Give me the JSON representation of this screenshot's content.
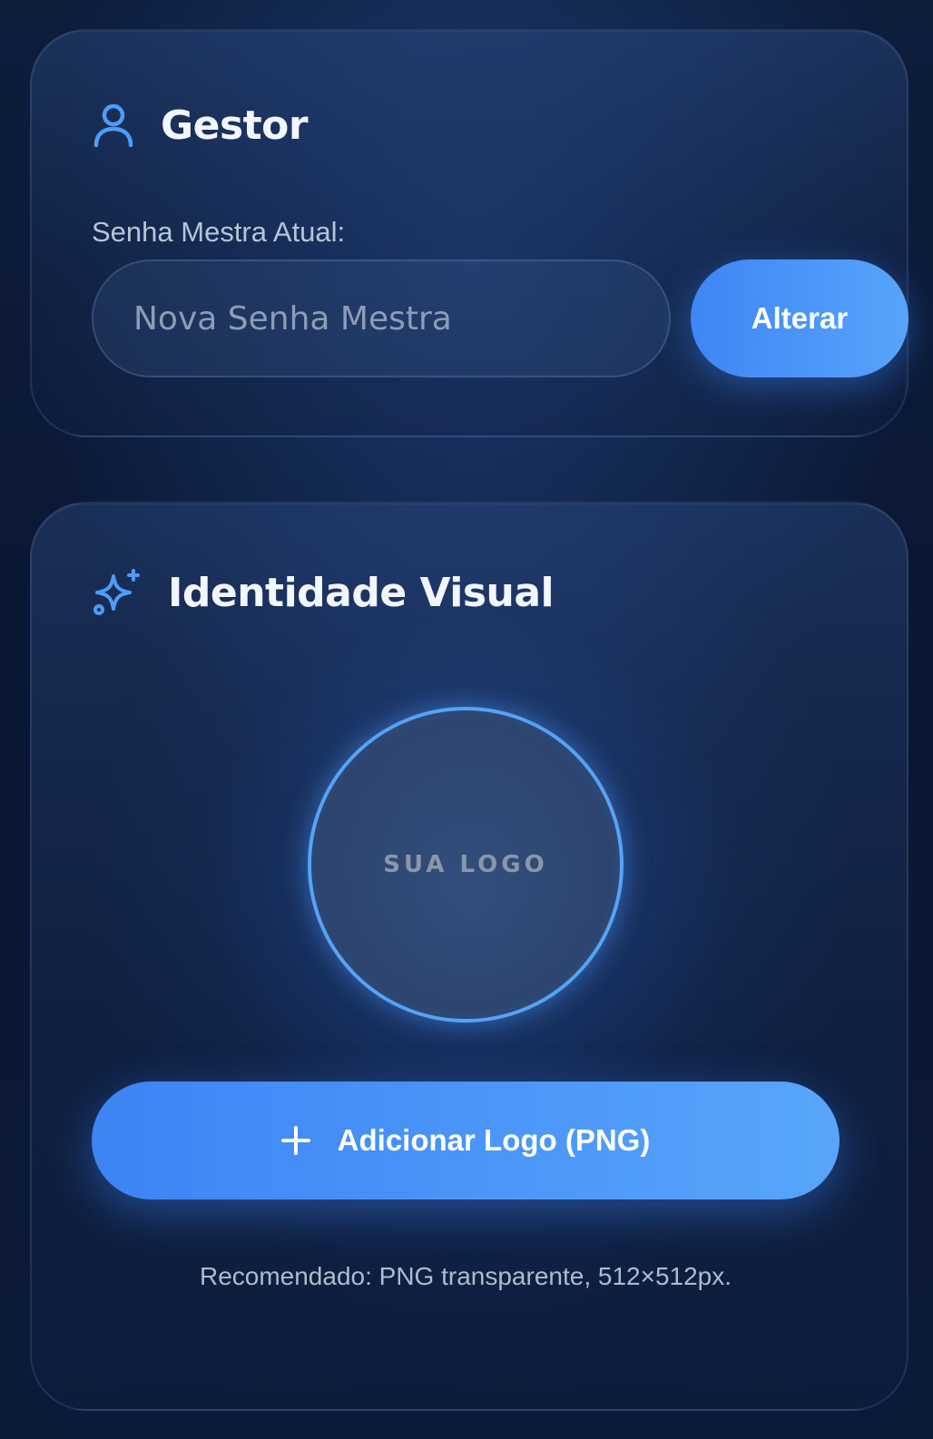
{
  "gestor": {
    "title": "Gestor",
    "icon": "user-icon",
    "password_label": "Senha Mestra Atual:",
    "password_placeholder": "Nova Senha Mestra",
    "password_value": "",
    "change_button_label": "Alterar"
  },
  "identity": {
    "title": "Identidade Visual",
    "icon": "sparkles-icon",
    "logo_placeholder": "SUA LOGO",
    "add_logo_button_label": "Adicionar Logo (PNG)",
    "add_logo_icon": "plus-icon",
    "hint": "Recomendado: PNG transparente, 512×512px."
  },
  "colors": {
    "accent": "#4a96f8",
    "background": "#0b1a38"
  }
}
